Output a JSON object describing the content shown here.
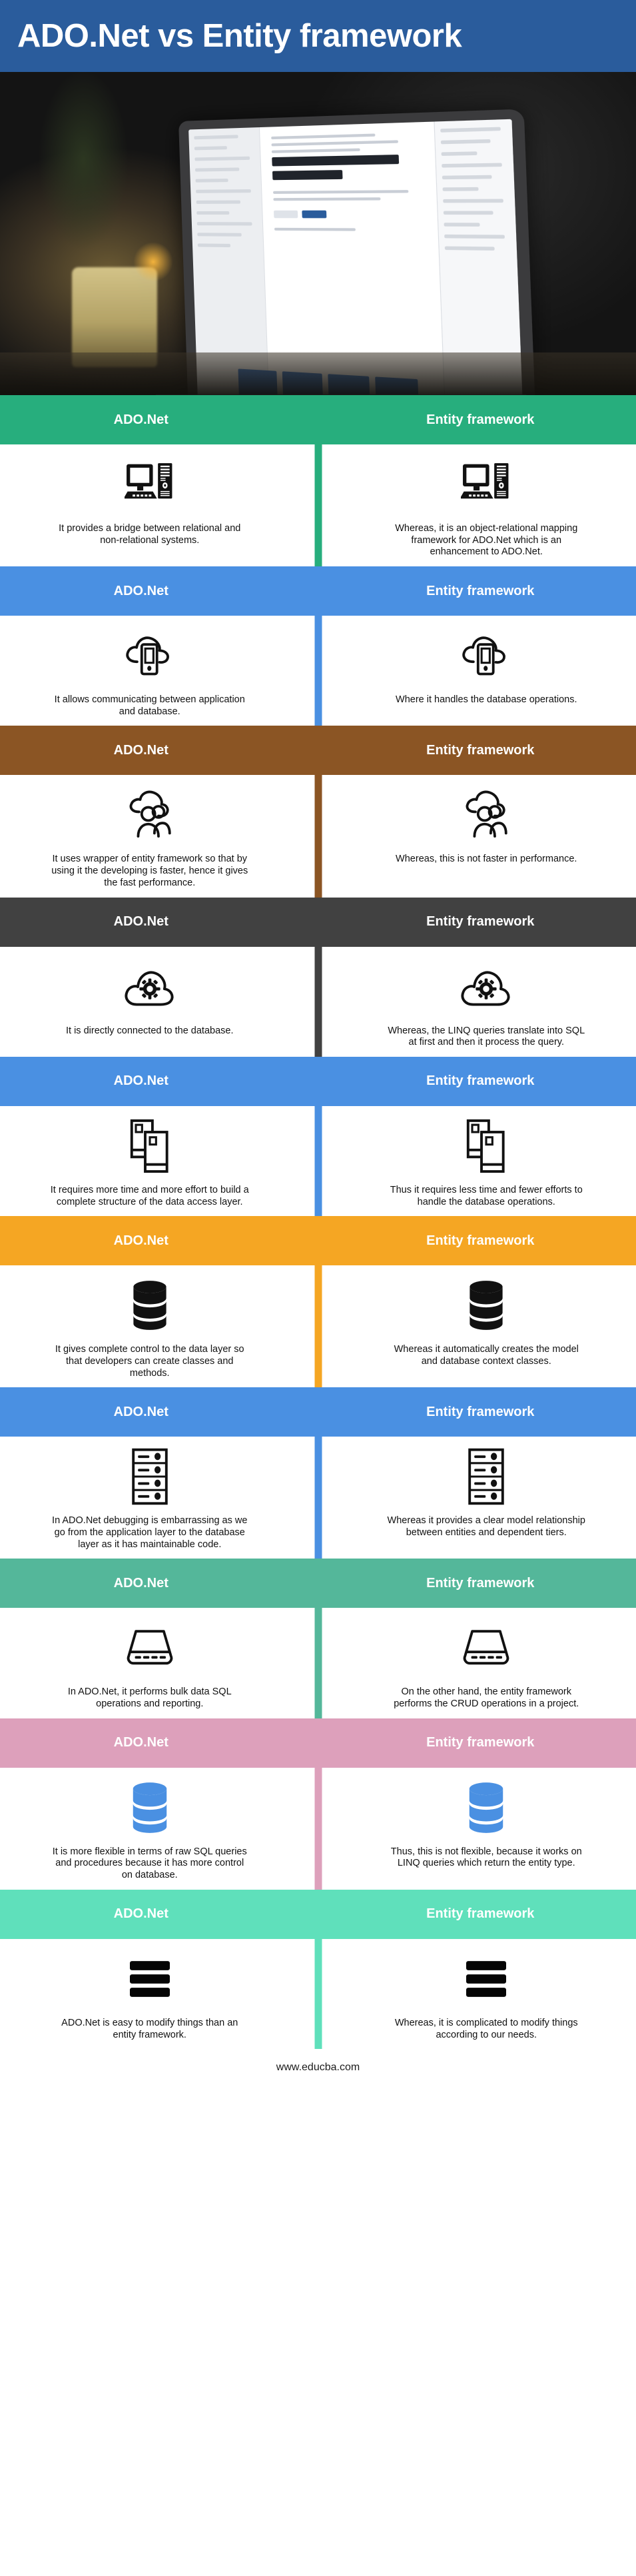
{
  "title": "ADO.Net vs Entity framework",
  "title_bar_color": "#2a5c9c",
  "hero": {
    "alt": "laptop-photo"
  },
  "column_headers": {
    "left": "ADO.Net",
    "right": "Entity framework"
  },
  "footer": {
    "url": "www.educba.com"
  },
  "sections": [
    {
      "color": "#27ae7d",
      "icon": "desktop-computer-icon",
      "header_left": "ADO.Net",
      "header_right": "Entity framework",
      "left_text": "It provides a bridge between relational and non-relational systems.",
      "right_text": "Whereas, it is an object-relational mapping framework for ADO.Net which is an enhancement to ADO.Net."
    },
    {
      "color": "#4a90e2",
      "icon": "cloud-mobile-icon",
      "header_left": "ADO.Net",
      "header_right": "Entity framework",
      "left_text": "It allows communicating between application and database.",
      "right_text": "Where it handles the database operations."
    },
    {
      "color": "#8b5524",
      "icon": "users-group-icon",
      "header_left": "ADO.Net",
      "header_right": "Entity framework",
      "left_text": "It uses wrapper of entity framework so that by using it the developing is faster, hence it gives the fast performance.",
      "right_text": "Whereas, this is not faster in performance."
    },
    {
      "color": "#414141",
      "icon": "cloud-gear-icon",
      "header_left": "ADO.Net",
      "header_right": "Entity framework",
      "left_text": "It is directly connected to the database.",
      "right_text": "Whereas, the LINQ queries translate into SQL at first and then it process the query."
    },
    {
      "color": "#4a90e2",
      "icon": "documents-stack-icon",
      "header_left": "ADO.Net",
      "header_right": "Entity framework",
      "left_text": "It requires more time and more effort to build a complete structure of the data access layer.",
      "right_text": "Thus it requires less time and fewer efforts to handle the database operations."
    },
    {
      "color": "#f5a623",
      "icon": "database-cylinder-icon",
      "header_left": "ADO.Net",
      "header_right": "Entity framework",
      "left_text": "It gives complete control to the data layer so that developers can create classes and methods.",
      "right_text": "Whereas it automatically creates the model and database context classes."
    },
    {
      "color": "#4a90e2",
      "icon": "server-rack-icon",
      "header_left": "ADO.Net",
      "header_right": "Entity framework",
      "left_text": "In ADO.Net debugging is embarrassing as we go from the application layer to the database layer as it has maintainable code.",
      "right_text": "Whereas it provides a clear model relationship between entities and dependent tiers."
    },
    {
      "color": "#54b79a",
      "icon": "storage-drive-icon",
      "header_left": "ADO.Net",
      "header_right": "Entity framework",
      "left_text": "In ADO.Net, it performs bulk data SQL operations and reporting.",
      "right_text": "On the other hand, the entity framework performs the CRUD operations in a project."
    },
    {
      "color": "#dda0bb",
      "icon": "blue-database-icon",
      "header_left": "ADO.Net",
      "header_right": "Entity framework",
      "left_text": "It is more flexible in terms of raw SQL queries and procedures because it has more control on database.",
      "right_text": "Thus, this is not flexible, because it works on LINQ queries which return the entity type."
    },
    {
      "color": "#5fe0bb",
      "icon": "stacked-bars-icon",
      "header_left": "ADO.Net",
      "header_right": "Entity framework",
      "left_text": "ADO.Net is easy to modify things than an entity framework.",
      "right_text": "Whereas, it is complicated to modify things according to our needs."
    }
  ]
}
